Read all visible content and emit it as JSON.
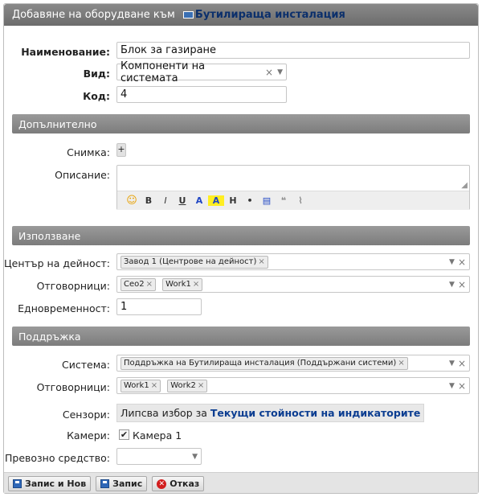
{
  "title": {
    "prefix": "Добавяне на оборудване към",
    "link": "Бутилираща инсталация"
  },
  "fields": {
    "name_label": "Наименование",
    "name_value": "Блок за газиране",
    "kind_label": "Вид",
    "kind_value": "Компоненти на системата",
    "code_label": "Код",
    "code_value": "4"
  },
  "sections": {
    "additional": "Допълнително",
    "usage": "Използване",
    "maintenance": "Поддръжка"
  },
  "additional": {
    "photo_label": "Снимка:",
    "photo_add": "+",
    "description_label": "Описание:",
    "toolbar": {
      "bold": "B",
      "italic": "I",
      "underline": "U",
      "color": "A",
      "highlight": "A",
      "heading": "H",
      "bullet": "•"
    }
  },
  "usage": {
    "center_label": "Център на дейност:",
    "center_tags": [
      "Завод 1 (Центрове на дейност)"
    ],
    "responsible_label": "Отговорници:",
    "responsible_tags": [
      "Ceo2",
      "Work1"
    ],
    "concurrent_label": "Едновременност:",
    "concurrent_value": "1"
  },
  "maintenance": {
    "system_label": "Система:",
    "system_tags": [
      "Поддръжка на Бутилираща инсталация (Поддържани системи)"
    ],
    "responsible_label": "Отговорници:",
    "responsible_tags": [
      "Work1",
      "Work2"
    ],
    "sensors_label": "Сензори:",
    "sensors_text": "Липсва избор за",
    "sensors_link": "Текущи стойности на индикаторите",
    "cameras_label": "Камери:",
    "camera_name": "Камера 1",
    "camera_checked": true,
    "vehicle_label": "Превозно средство:"
  },
  "footer": {
    "save_new": "Запис и Нов",
    "save": "Запис",
    "cancel": "Отказ"
  }
}
